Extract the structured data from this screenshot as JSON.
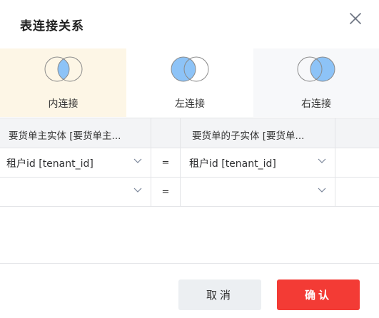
{
  "dialog": {
    "title": "表连接关系",
    "close_icon": "close-icon"
  },
  "join_types": [
    {
      "label": "内连接",
      "icon": "inner-join-icon",
      "bg": "#fdf6e6",
      "selected": true
    },
    {
      "label": "左连接",
      "icon": "left-join-icon",
      "bg": "#ffffff",
      "selected": false
    },
    {
      "label": "右连接",
      "icon": "right-join-icon",
      "bg": "#f7f8fa",
      "selected": false
    }
  ],
  "grid": {
    "headers": {
      "left": "要货单主实体 [要货单主...",
      "right": "要货单的子实体 [要货单..."
    },
    "rows": [
      {
        "left_value": "租户id [tenant_id]",
        "operator": "=",
        "right_value": "租户id [tenant_id]"
      },
      {
        "left_value": "",
        "operator": "=",
        "right_value": ""
      }
    ]
  },
  "footer": {
    "cancel_label": "取消",
    "ok_label": "确认"
  },
  "colors": {
    "primary": "#f33b35",
    "venn_fill": "#8dc3f7",
    "venn_stroke": "#8a8a8a"
  }
}
